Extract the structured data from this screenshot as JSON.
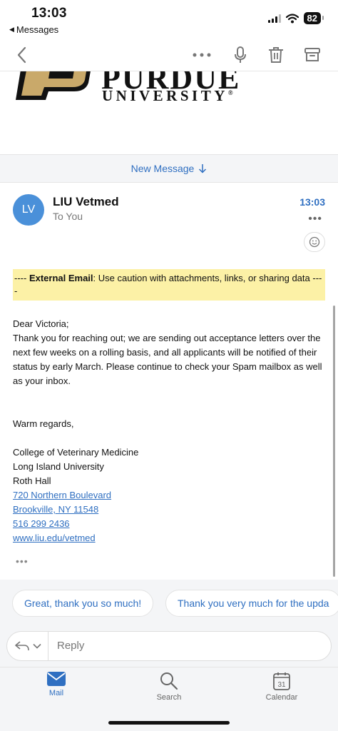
{
  "status_bar": {
    "time": "13:03",
    "back_app": "Messages",
    "battery": "82"
  },
  "toolbar": {
    "back_icon": "chevron-left-icon",
    "more_icon": "more-horizontal-icon",
    "mic_icon": "microphone-icon",
    "delete_icon": "trash-icon",
    "archive_icon": "archive-icon"
  },
  "logo": {
    "line1": "PURDUE",
    "line2": "UNIVERSITY",
    "colors": {
      "gold": "#c9a96a",
      "black": "#111111"
    }
  },
  "new_message": {
    "label": "New Message"
  },
  "email": {
    "avatar_initials": "LV",
    "sender": "LIU Vetmed",
    "to": "To You",
    "time": "13:03",
    "banner_prefix": "---- ",
    "banner_bold": "External Email",
    "banner_rest": ": Use caution with attachments, links, or sharing data ----",
    "greeting": "Dear Victoria;",
    "paragraph": "Thank you for reaching out; we are sending out acceptance letters over the next few weeks on a rolling basis, and all applicants will be notified of their status by early March. Please continue to check your Spam mailbox as well as your inbox.",
    "closing": "Warm regards,",
    "signature": {
      "org": "College of Veterinary Medicine",
      "university": "Long Island University",
      "building": "Roth Hall",
      "street": "720 Northern Boulevard",
      "city": "Brookville, NY 11548",
      "phone": "516 299 2436",
      "website": "www.liu.edu/vetmed"
    }
  },
  "quick_replies": [
    "Great, thank you so much!",
    "Thank you very much for the upda"
  ],
  "reply": {
    "placeholder": "Reply"
  },
  "tabs": [
    {
      "label": "Mail",
      "icon": "mail-icon",
      "active": true
    },
    {
      "label": "Search",
      "icon": "search-icon",
      "active": false
    },
    {
      "label": "Calendar",
      "icon": "calendar-icon",
      "active": false,
      "day": "31"
    }
  ],
  "colors": {
    "accent": "#2f6fc1",
    "banner": "#fcf1a6",
    "avatar": "#4a90d9"
  }
}
